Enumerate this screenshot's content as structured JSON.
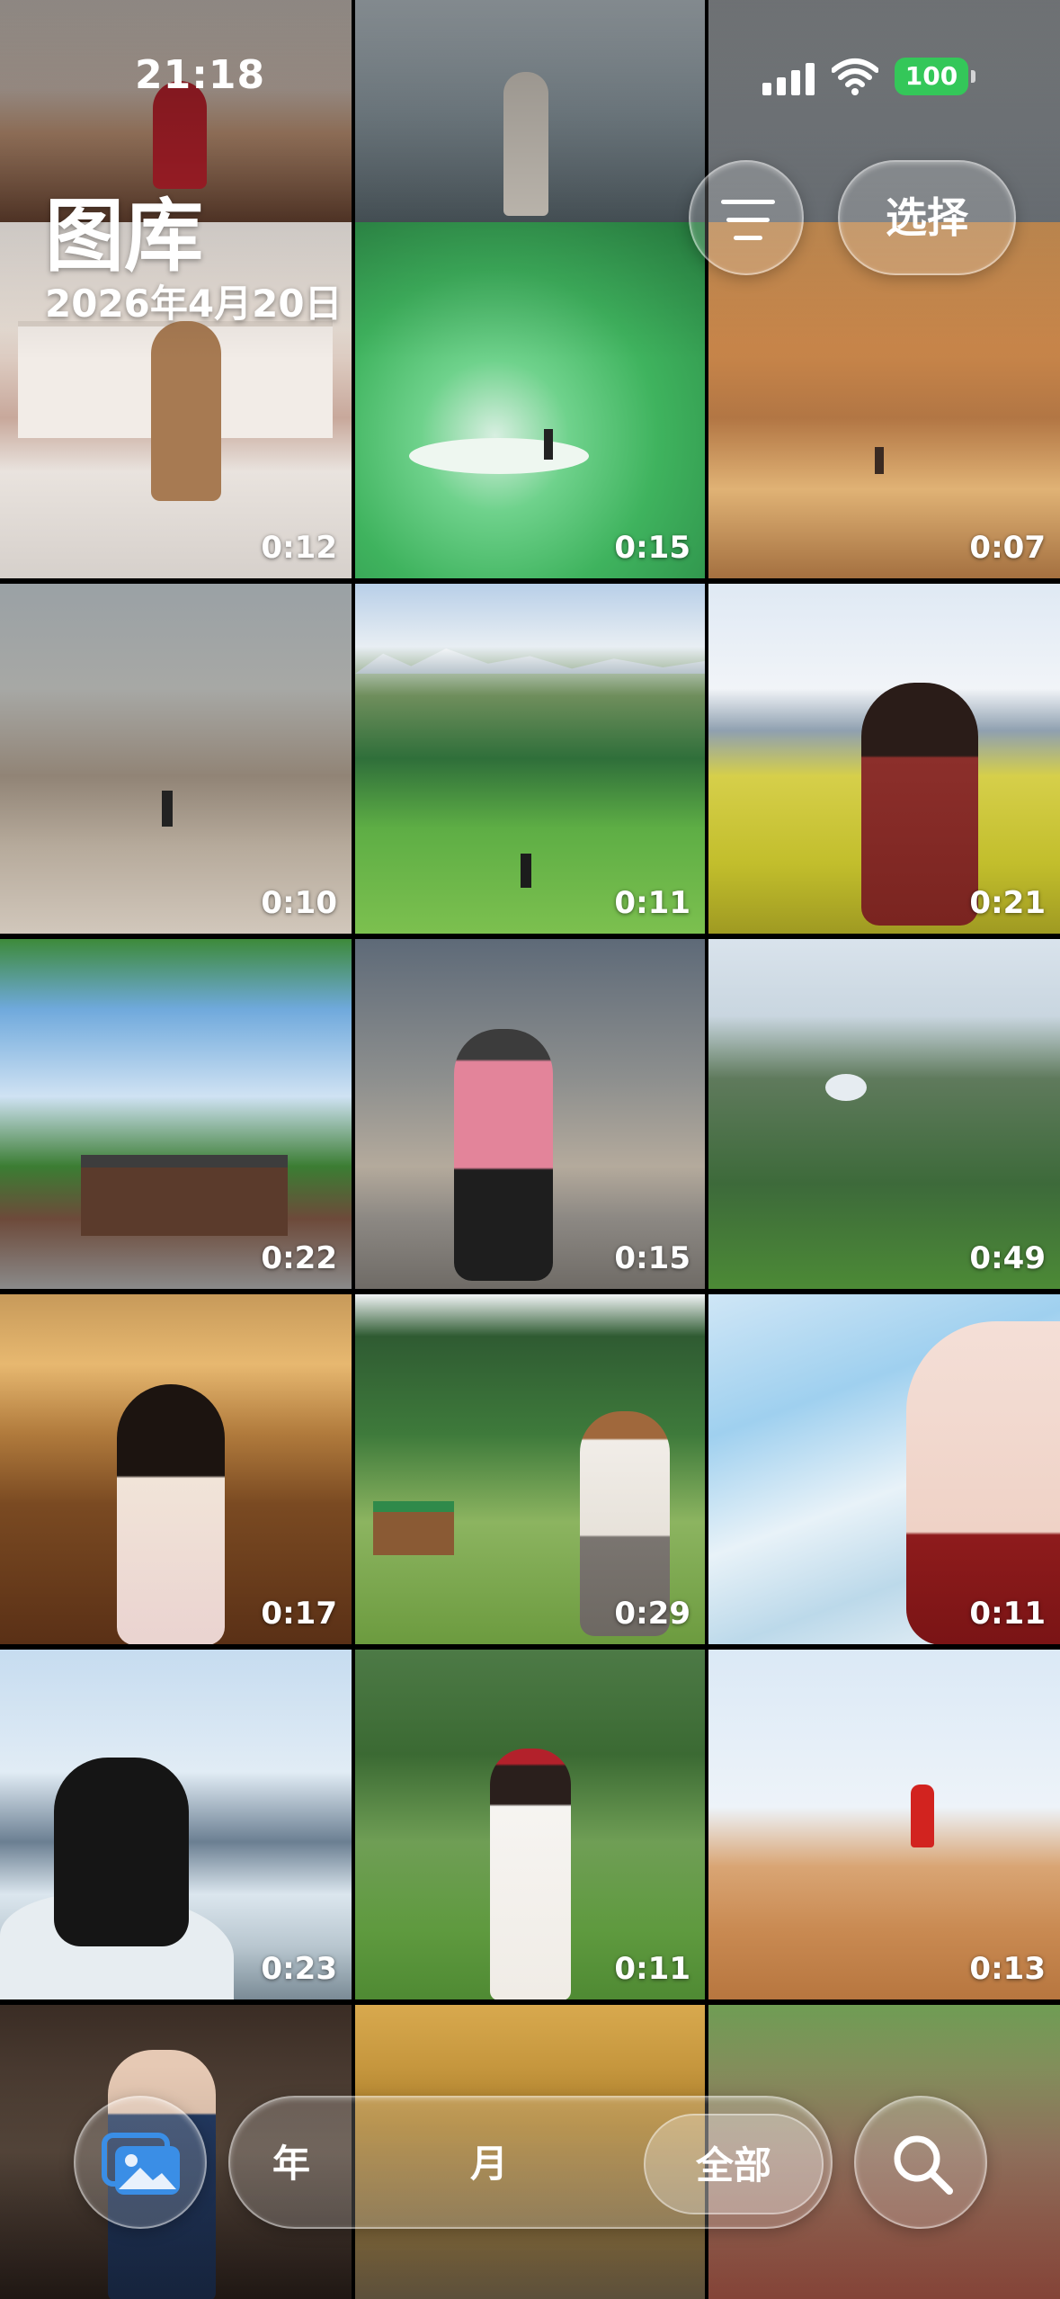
{
  "status": {
    "time": "21:18",
    "battery": "100"
  },
  "header": {
    "title": "图库",
    "date": "2026年4月20日"
  },
  "toolbar": {
    "select_label": "选择"
  },
  "grid": {
    "rows": [
      [
        {
          "duration": ""
        },
        {
          "duration": ""
        },
        {
          "duration": ""
        }
      ],
      [
        {
          "duration": "0:12"
        },
        {
          "duration": "0:15"
        },
        {
          "duration": "0:07"
        }
      ],
      [
        {
          "duration": "0:10"
        },
        {
          "duration": "0:11"
        },
        {
          "duration": "0:21"
        }
      ],
      [
        {
          "duration": "0:22"
        },
        {
          "duration": "0:15"
        },
        {
          "duration": "0:49"
        }
      ],
      [
        {
          "duration": "0:17"
        },
        {
          "duration": "0:29"
        },
        {
          "duration": "0:11"
        }
      ],
      [
        {
          "duration": "0:23"
        },
        {
          "duration": "0:11"
        },
        {
          "duration": "0:13"
        }
      ],
      [
        {
          "duration": ""
        },
        {
          "duration": ""
        },
        {
          "duration": ""
        }
      ]
    ]
  },
  "bottom_bar": {
    "segments": [
      {
        "label": "年"
      },
      {
        "label": "月"
      },
      {
        "label": "全部"
      }
    ],
    "active_segment": "全部",
    "icons": {
      "library": "photo-library-icon",
      "search": "search-icon"
    }
  },
  "colors": {
    "battery": "#34c759",
    "library_icon": "#3a8ee6"
  }
}
